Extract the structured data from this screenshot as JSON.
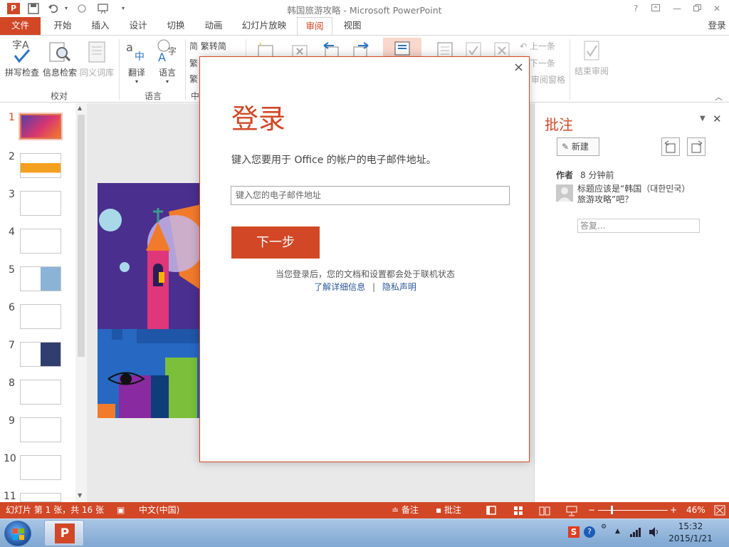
{
  "window": {
    "title": "韩国旅游攻略 - Microsoft PowerPoint",
    "help": "?",
    "signin": "登录"
  },
  "tabs": [
    "文件",
    "开始",
    "插入",
    "设计",
    "切换",
    "动画",
    "幻灯片放映",
    "审阅",
    "视图"
  ],
  "ribbon": {
    "spell_check": "拼写检查",
    "research": "信息检索",
    "thesaurus": "同义词库",
    "translate": "翻译",
    "language": "语言",
    "trad_to_simp": "繁转简",
    "prev_comment": "上一条",
    "next_comment": "下一条",
    "review_pane": "审阅窗格",
    "end_review": "结束审阅",
    "group_proofing": "校对",
    "group_language": "语言",
    "group_chinese": "中"
  },
  "thumbnails": [
    "1",
    "2",
    "3",
    "4",
    "5",
    "6",
    "7",
    "8",
    "9",
    "10",
    "11"
  ],
  "dialog": {
    "title": "登录",
    "instruction": "键入您要用于 Office 的帐户的电子邮件地址。",
    "email_placeholder": "键入您的电子邮件地址",
    "next": "下一步",
    "note": "当您登录后，您的文档和设置都会处于联机状态",
    "learn_more": "了解详细信息",
    "divider": "|",
    "privacy": "隐私声明",
    "close": "×"
  },
  "comments": {
    "title": "批注",
    "new_button": "新建",
    "author": "作者",
    "time": "8 分钟前",
    "text": "标题应该是“韩国（대한민국）旅游攻略”吧？",
    "reply_placeholder": "答复..."
  },
  "status": {
    "slide_info": "幻灯片 第 1 张，共 16 张",
    "language": "中文(中国)",
    "notes": "备注",
    "comments": "批注",
    "zoom": "46%"
  },
  "taskbar": {
    "time": "15:32",
    "date": "2015/1/21",
    "app_letter": "P"
  },
  "colors": {
    "accent": "#d24726",
    "link": "#2b579a"
  }
}
